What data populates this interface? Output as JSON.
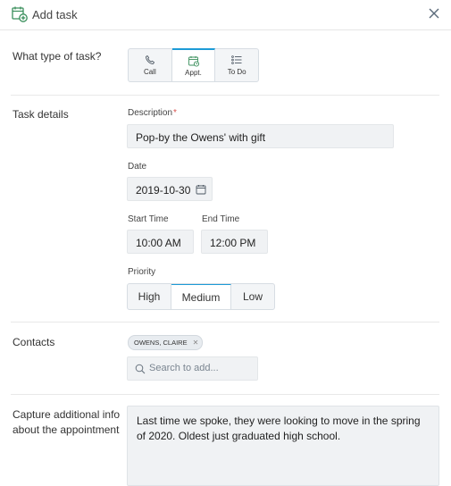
{
  "header": {
    "title": "Add task",
    "icon": "calendar-add-icon",
    "close_icon": "close-icon"
  },
  "task_type": {
    "label": "What type of task?",
    "options": [
      {
        "label": "Call",
        "icon": "phone-icon",
        "selected": false
      },
      {
        "label": "Appt.",
        "icon": "calendar-icon",
        "selected": true
      },
      {
        "label": "To Do",
        "icon": "list-icon",
        "selected": false
      }
    ]
  },
  "details": {
    "label": "Task details",
    "description_label": "Description",
    "required_mark": "*",
    "description_value": "Pop-by the Owens' with gift",
    "date_label": "Date",
    "date_value": "2019-10-30",
    "start_time_label": "Start Time",
    "start_time_value": "10:00 AM",
    "end_time_label": "End Time",
    "end_time_value": "12:00 PM",
    "priority_label": "Priority",
    "priority_options": [
      "High",
      "Medium",
      "Low"
    ],
    "priority_selected": "Medium"
  },
  "contacts": {
    "label": "Contacts",
    "chips": [
      {
        "label": "OWENS, CLAIRE"
      }
    ],
    "search_placeholder": "Search to add..."
  },
  "additional": {
    "label_line1": "Capture additional info",
    "label_line2": "about the appointment",
    "value": "Last time we spoke, they were looking to move in the spring of 2020. Oldest just graduated high school."
  },
  "colors": {
    "accent": "#1d9bd7",
    "icon_green": "#3a8f5c",
    "required": "#d9534f",
    "input_bg": "#f0f2f4"
  }
}
